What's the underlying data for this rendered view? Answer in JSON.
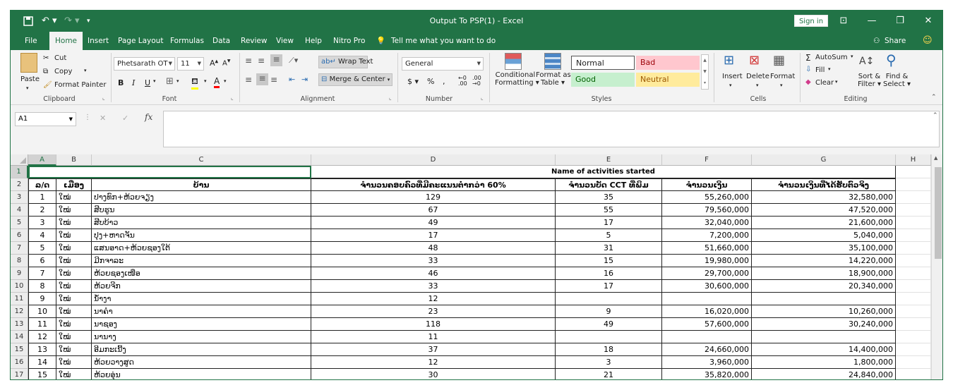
{
  "window": {
    "title": "Output To PSP(1)  -  Excel",
    "signin": "Sign in",
    "share": "Share"
  },
  "menu": {
    "items": [
      "File",
      "Home",
      "Insert",
      "Page Layout",
      "Formulas",
      "Data",
      "Review",
      "View",
      "Help",
      "Nitro Pro"
    ],
    "tell_me": "Tell me what you want to do"
  },
  "ribbon": {
    "clipboard": {
      "paste": "Paste",
      "cut": "Cut",
      "copy": "Copy",
      "format_painter": "Format Painter",
      "label": "Clipboard"
    },
    "font": {
      "name": "Phetsarath OT",
      "size": "11",
      "label": "Font"
    },
    "alignment": {
      "wrap": "Wrap Text",
      "merge": "Merge & Center",
      "label": "Alignment"
    },
    "number": {
      "format": "General",
      "label": "Number"
    },
    "styles": {
      "conditional1": "Conditional",
      "conditional2": "Formatting",
      "format_as1": "Format as",
      "format_as2": "Table",
      "normal": "Normal",
      "bad": "Bad",
      "good": "Good",
      "neutral": "Neutral",
      "label": "Styles"
    },
    "cells": {
      "insert": "Insert",
      "delete": "Delete",
      "format": "Format",
      "label": "Cells"
    },
    "editing": {
      "autosum": "AutoSum",
      "fill": "Fill",
      "clear": "Clear",
      "sort1": "Sort &",
      "sort2": "Filter",
      "find1": "Find &",
      "find2": "Select",
      "label": "Editing"
    }
  },
  "formula_bar": {
    "name_box": "A1",
    "fx": "fx"
  },
  "sheet": {
    "columns": [
      "A",
      "B",
      "C",
      "D",
      "E",
      "F",
      "G",
      "H"
    ],
    "row_numbers": [
      "1",
      "2",
      "3",
      "4",
      "5",
      "6",
      "7",
      "8",
      "9",
      "10",
      "11",
      "12",
      "13",
      "14",
      "15",
      "16",
      "17"
    ],
    "merged_title": "Name of activities started",
    "headers": [
      "ລ/ດ",
      "ເມືອງ",
      "ບ້ານ",
      "ຈຳນວນຄອບຄົວທີ່ມີຄະແນນຕ່ຳກວ່າ 60%",
      "ຈຳນວນບັດ CCT ທີ່ພິມ",
      "ຈຳນວນເງິນ",
      "ຈຳນວນເງິນທີ່ໄດ້ຮັບຕົວຈິງ"
    ],
    "rows": [
      [
        "1",
        "ໃໝ່",
        "ປາງທົກ+ຫ້ວຍຈຽງ",
        "129",
        "35",
        "55,260,000",
        "32,580,000"
      ],
      [
        "2",
        "ໃໝ່",
        "ສີບຮູນ",
        "67",
        "55",
        "79,560,000",
        "47,520,000"
      ],
      [
        "3",
        "ໃໝ່",
        "ສີບບ້າວ",
        "49",
        "17",
        "32,040,000",
        "21,600,000"
      ],
      [
        "4",
        "ໃໝ່",
        "ປຸງ+ຫາດຈັນ",
        "17",
        "5",
        "7,200,000",
        "5,040,000"
      ],
      [
        "5",
        "ໃໝ່",
        "ແສນອາດ+ຫ້ວຍຊອງໃຕ້",
        "48",
        "31",
        "51,660,000",
        "35,100,000"
      ],
      [
        "6",
        "ໃໝ່",
        "ມີກຈາລະ",
        "33",
        "15",
        "19,980,000",
        "14,220,000"
      ],
      [
        "7",
        "ໃໝ່",
        "ຫ້ວຍຊອງເໜືອ",
        "46",
        "16",
        "29,700,000",
        "18,900,000"
      ],
      [
        "8",
        "ໃໝ່",
        "ຫ້ວຍຈີກ",
        "33",
        "17",
        "30,600,000",
        "20,340,000"
      ],
      [
        "9",
        "ໃໝ່",
        "ນ້ຳງາ",
        "12",
        "",
        "",
        ""
      ],
      [
        "10",
        "ໃໝ່",
        "ນາຄຳ",
        "23",
        "9",
        "16,020,000",
        "10,260,000"
      ],
      [
        "11",
        "ໃໝ່",
        "ນາຊອງ",
        "118",
        "49",
        "57,600,000",
        "30,240,000"
      ],
      [
        "12",
        "ໃໝ່",
        "ນານາງ",
        "11",
        "",
        "",
        ""
      ],
      [
        "13",
        "ໃໝ່",
        "ອີມກະເນີ້ງ",
        "37",
        "18",
        "24,660,000",
        "14,400,000"
      ],
      [
        "14",
        "ໃໝ່",
        "ຫ້ວຍວາງສູດ",
        "12",
        "3",
        "3,960,000",
        "1,800,000"
      ],
      [
        "15",
        "ໃໝ່",
        "ຫ້ວຍອຸ່ນ",
        "30",
        "21",
        "35,820,000",
        "24,840,000"
      ]
    ]
  },
  "colors": {
    "accent": "#217346",
    "bad_bg": "#ffc7ce",
    "good_bg": "#c6efce",
    "neutral_bg": "#ffeb9c"
  }
}
